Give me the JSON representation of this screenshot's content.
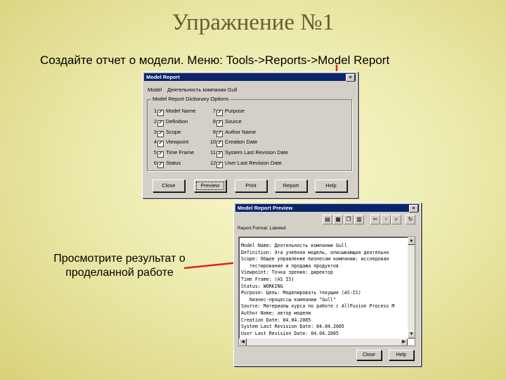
{
  "slide": {
    "title": "Упражнение №1",
    "subtitle": "Создайте отчет о модели. Меню: Tools->Reports->Model Report",
    "note": "Просмотрите результат о проделанной работе"
  },
  "model_report": {
    "title": "Model Report",
    "close_glyph": "×",
    "model_label": "Model",
    "model_value": "Деятельность компании Gull",
    "group_label": "Model Report Dictionary Options",
    "check_mark": "✓",
    "options_left": [
      {
        "num": "1",
        "label": "Model Name"
      },
      {
        "num": "2",
        "label": "Definition"
      },
      {
        "num": "3",
        "label": "Scope"
      },
      {
        "num": "4",
        "label": "Viewpoint"
      },
      {
        "num": "5",
        "label": "Time Frame"
      },
      {
        "num": "6",
        "label": "Status"
      }
    ],
    "options_right": [
      {
        "num": "7",
        "label": "Purpose"
      },
      {
        "num": "8",
        "label": "Source"
      },
      {
        "num": "9",
        "label": "Author Name"
      },
      {
        "num": "10",
        "label": "Creation Date"
      },
      {
        "num": "11",
        "label": "System Last Revision Date"
      },
      {
        "num": "12",
        "label": "User Last Revision Date"
      }
    ],
    "buttons": {
      "close": "Close",
      "preview": "Preview",
      "print": "Print",
      "report": "Report",
      "help": "Help"
    }
  },
  "preview": {
    "title": "Model Report Preview",
    "format_label": "Report Format: Labeled",
    "toolbar_icons": [
      {
        "name": "save-icon",
        "glyph": "▤"
      },
      {
        "name": "print-icon",
        "glyph": "▦"
      },
      {
        "name": "copy-icon",
        "glyph": "❐"
      },
      {
        "name": "paste-icon",
        "glyph": "▥"
      },
      {
        "name": "cut-icon",
        "glyph": "✂"
      },
      {
        "name": "find-icon",
        "glyph": "▫"
      },
      {
        "name": "search-icon",
        "glyph": "⌕"
      },
      {
        "name": "refresh-icon",
        "glyph": "↻"
      }
    ],
    "report_lines": [
      "Model Name: Деятельность компании Gull",
      "Definition: Эта учебная модель, описывающая деятельно",
      "Scope: Общее управление бизнесом компании: исследован",
      "   тестирование и продажа продуктов",
      "Viewpoint: Точка зрения: директор",
      "Time Frame: (AS IS)",
      "Status: WORKING",
      "Purpose: Цель: Моделировать текущие (AS-IS)",
      "   бизнес-процессы компании \"Gull\"",
      "Source: Материалы курса по работе с AllFusion Process M",
      "Author Name: автор модели",
      "Creation Date: 04.04.2005",
      "System Last Revision Date: 04.04.2005",
      "User Last Revision Date: 04.04.2005"
    ],
    "buttons": {
      "close": "Close",
      "help": "Help"
    }
  },
  "colors": {
    "arrow": "#e0201b",
    "titlebar": "#0a246a",
    "title_text": "#6b5a32"
  }
}
